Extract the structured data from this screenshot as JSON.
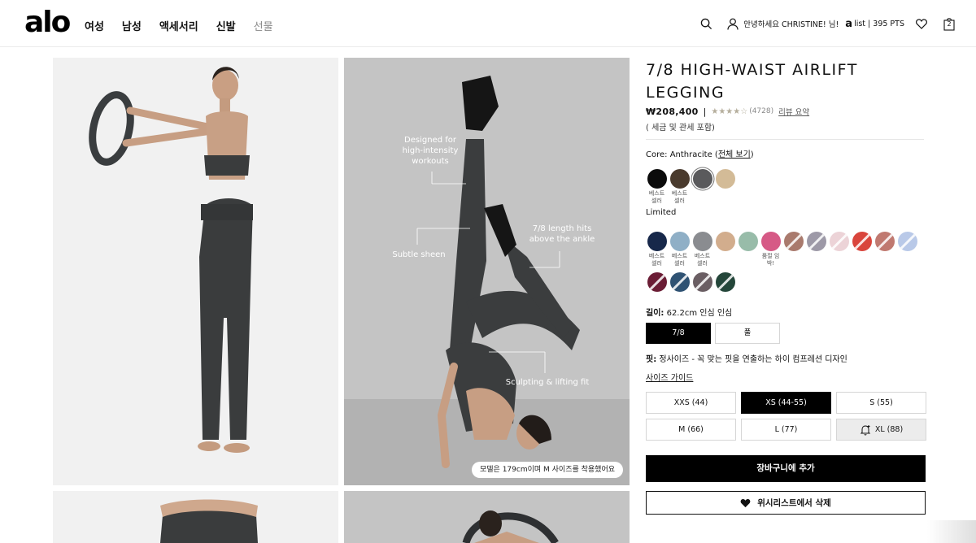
{
  "header": {
    "logo": "alo",
    "nav": [
      "여성",
      "남성",
      "액세서리",
      "신발",
      "선물"
    ],
    "greeting": "안녕하세요 CHRISTINE! 님!",
    "alist_mark": "a",
    "alist_points": "list | 395 PTS",
    "bag_count": "2"
  },
  "gallery": {
    "callouts": [
      "Designed for\nhigh-intensity\nworkouts",
      "7/8 length hits\nabove the ankle",
      "Subtle sheen",
      "Sculpting & lifting fit"
    ],
    "model_note": "모델은 179cm이며 M 사이즈를 착용했어요"
  },
  "product": {
    "title": "7/8 HIGH-WAIST AIRLIFT LEGGING",
    "price": "₩208,400",
    "separator": "|",
    "stars": "★★★★☆",
    "review_count": "(4728)",
    "review_link": "리뷰 요약",
    "tax_note": "( 세금 및 관세 포함)",
    "color_prefix": "Core: Anthracite (",
    "color_link": "전체 보기",
    "color_suffix": ")",
    "core_swatches": [
      {
        "color": "#0b0b0b",
        "label": "베스트\n셀러",
        "selected": false,
        "striped": false
      },
      {
        "color": "#4a3b2e",
        "label": "베스트\n셀러",
        "selected": false,
        "striped": false
      },
      {
        "color": "#5a5a5c",
        "label": "",
        "selected": true,
        "striped": false
      },
      {
        "color": "#d3bb97",
        "label": "",
        "selected": false,
        "striped": false
      }
    ],
    "limited_label": "Limited",
    "limited_swatches": [
      {
        "color": "#17284a",
        "label": "베스트\n셀러",
        "striped": false
      },
      {
        "color": "#8fafc6",
        "label": "베스트\n셀러",
        "striped": false
      },
      {
        "color": "#8a8c90",
        "label": "베스트\n셀러",
        "striped": false
      },
      {
        "color": "#d2ad8d",
        "label": "",
        "striped": false
      },
      {
        "color": "#98bca9",
        "label": "",
        "striped": false
      },
      {
        "color": "#d65a86",
        "label": "품절 임\n박!",
        "striped": false
      },
      {
        "color": "#a97a6d",
        "label": "",
        "striped": true
      },
      {
        "color": "#9d99a7",
        "label": "",
        "striped": true
      },
      {
        "color": "#ecd3d7",
        "label": "",
        "striped": true
      },
      {
        "color": "#d9453c",
        "label": "",
        "striped": true
      },
      {
        "color": "#c07970",
        "label": "",
        "striped": true
      },
      {
        "color": "#b9c9e8",
        "label": "",
        "striped": true
      }
    ],
    "limited_swatches_row2": [
      {
        "color": "#6b1d35",
        "label": "",
        "striped": true
      },
      {
        "color": "#2f5273",
        "label": "",
        "striped": true
      },
      {
        "color": "#6a5e63",
        "label": "",
        "striped": true
      },
      {
        "color": "#24463a",
        "label": "",
        "striped": true
      }
    ],
    "length_label": "길이:",
    "length_value": " 62.2cm 인심 인심",
    "lengths": [
      {
        "label": "7/8",
        "active": true
      },
      {
        "label": "풀",
        "active": false
      }
    ],
    "fit_label": "핏:",
    "fit_value": " 정사이즈 - 꼭 맞는 핏을 연출하는 하이 컴프레션 디자인",
    "size_guide": "사이즈 가이드",
    "sizes": [
      {
        "label": "XXS (44)",
        "active": false,
        "soldout": false
      },
      {
        "label": "XS (44-55)",
        "active": true,
        "soldout": false
      },
      {
        "label": "S (55)",
        "active": false,
        "soldout": false
      },
      {
        "label": "M (66)",
        "active": false,
        "soldout": false
      },
      {
        "label": "L (77)",
        "active": false,
        "soldout": false
      },
      {
        "label": "XL (88)",
        "active": false,
        "soldout": true
      }
    ],
    "add_to_cart": "장바구니에 추가",
    "wishlist_remove": "위시리스트에서 삭제"
  }
}
